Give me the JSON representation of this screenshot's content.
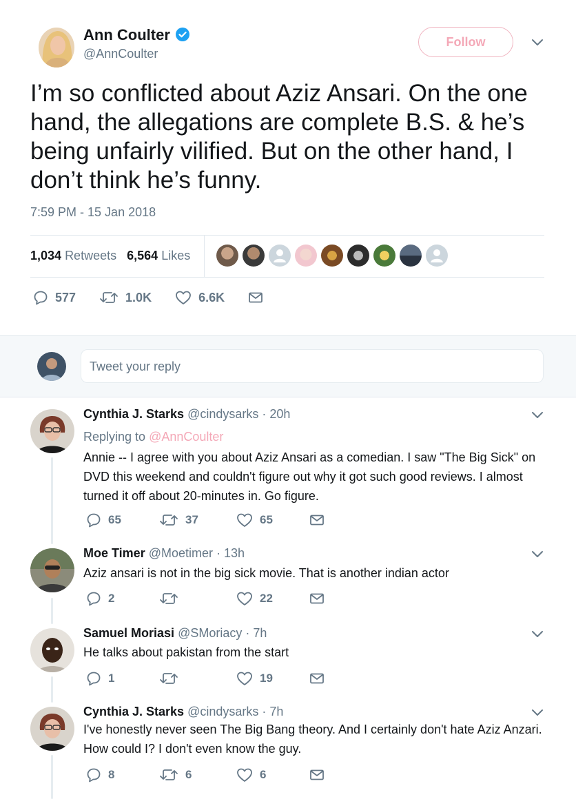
{
  "tweet": {
    "author_name": "Ann Coulter",
    "author_handle": "@AnnCoulter",
    "follow_label": "Follow",
    "text": "I’m so conflicted about Aziz Ansari.  On the one hand, the allegations are complete B.S. & he’s being unfairly vilified.  But on the other hand, I don’t think he’s funny.",
    "timestamp": "7:59 PM - 15 Jan 2018",
    "retweets_count": "1,034",
    "retweets_label": "Retweets",
    "likes_count": "6,564",
    "likes_label": "Likes",
    "actions": {
      "replies": "577",
      "retweets": "1.0K",
      "likes": "6.6K"
    }
  },
  "composer": {
    "placeholder": "Tweet your reply"
  },
  "replies": [
    {
      "name": "Cynthia J. Starks",
      "handle": "@cindysarks",
      "time": "· 20h",
      "replying_label": "Replying to",
      "replying_to": "@AnnCoulter",
      "text": "Annie -- I agree with you about Aziz Ansari as a comedian. I saw \"The Big Sick\" on DVD this weekend and couldn't figure out why it got such good reviews. I almost turned it off about 20-minutes in. Go figure.",
      "replies": "65",
      "retweets": "37",
      "likes": "65"
    },
    {
      "name": "Moe Timer",
      "handle": "@Moetimer",
      "time": "· 13h",
      "text": "Aziz ansari is not in the big sick movie. That is another indian actor",
      "replies": "2",
      "retweets": "",
      "likes": "22"
    },
    {
      "name": "Samuel Moriasi",
      "handle": "@SMoriacy",
      "time": "· 7h",
      "text": "He talks about pakistan from the start",
      "replies": "1",
      "retweets": "",
      "likes": "19"
    },
    {
      "name": "Cynthia J. Starks",
      "handle": "@cindysarks",
      "time": "· 7h",
      "text": "I've honestly never seen The Big Bang theory. And I certainly don't hate Aziz Anzari. How could I?  I don't even know the guy.",
      "replies": "8",
      "retweets": "6",
      "likes": "6"
    }
  ],
  "colors": {
    "accent": "#1da1f2",
    "follow_pink": "#f4a8b7",
    "muted": "#657786",
    "text": "#14171a",
    "border": "#e1e8ed"
  }
}
